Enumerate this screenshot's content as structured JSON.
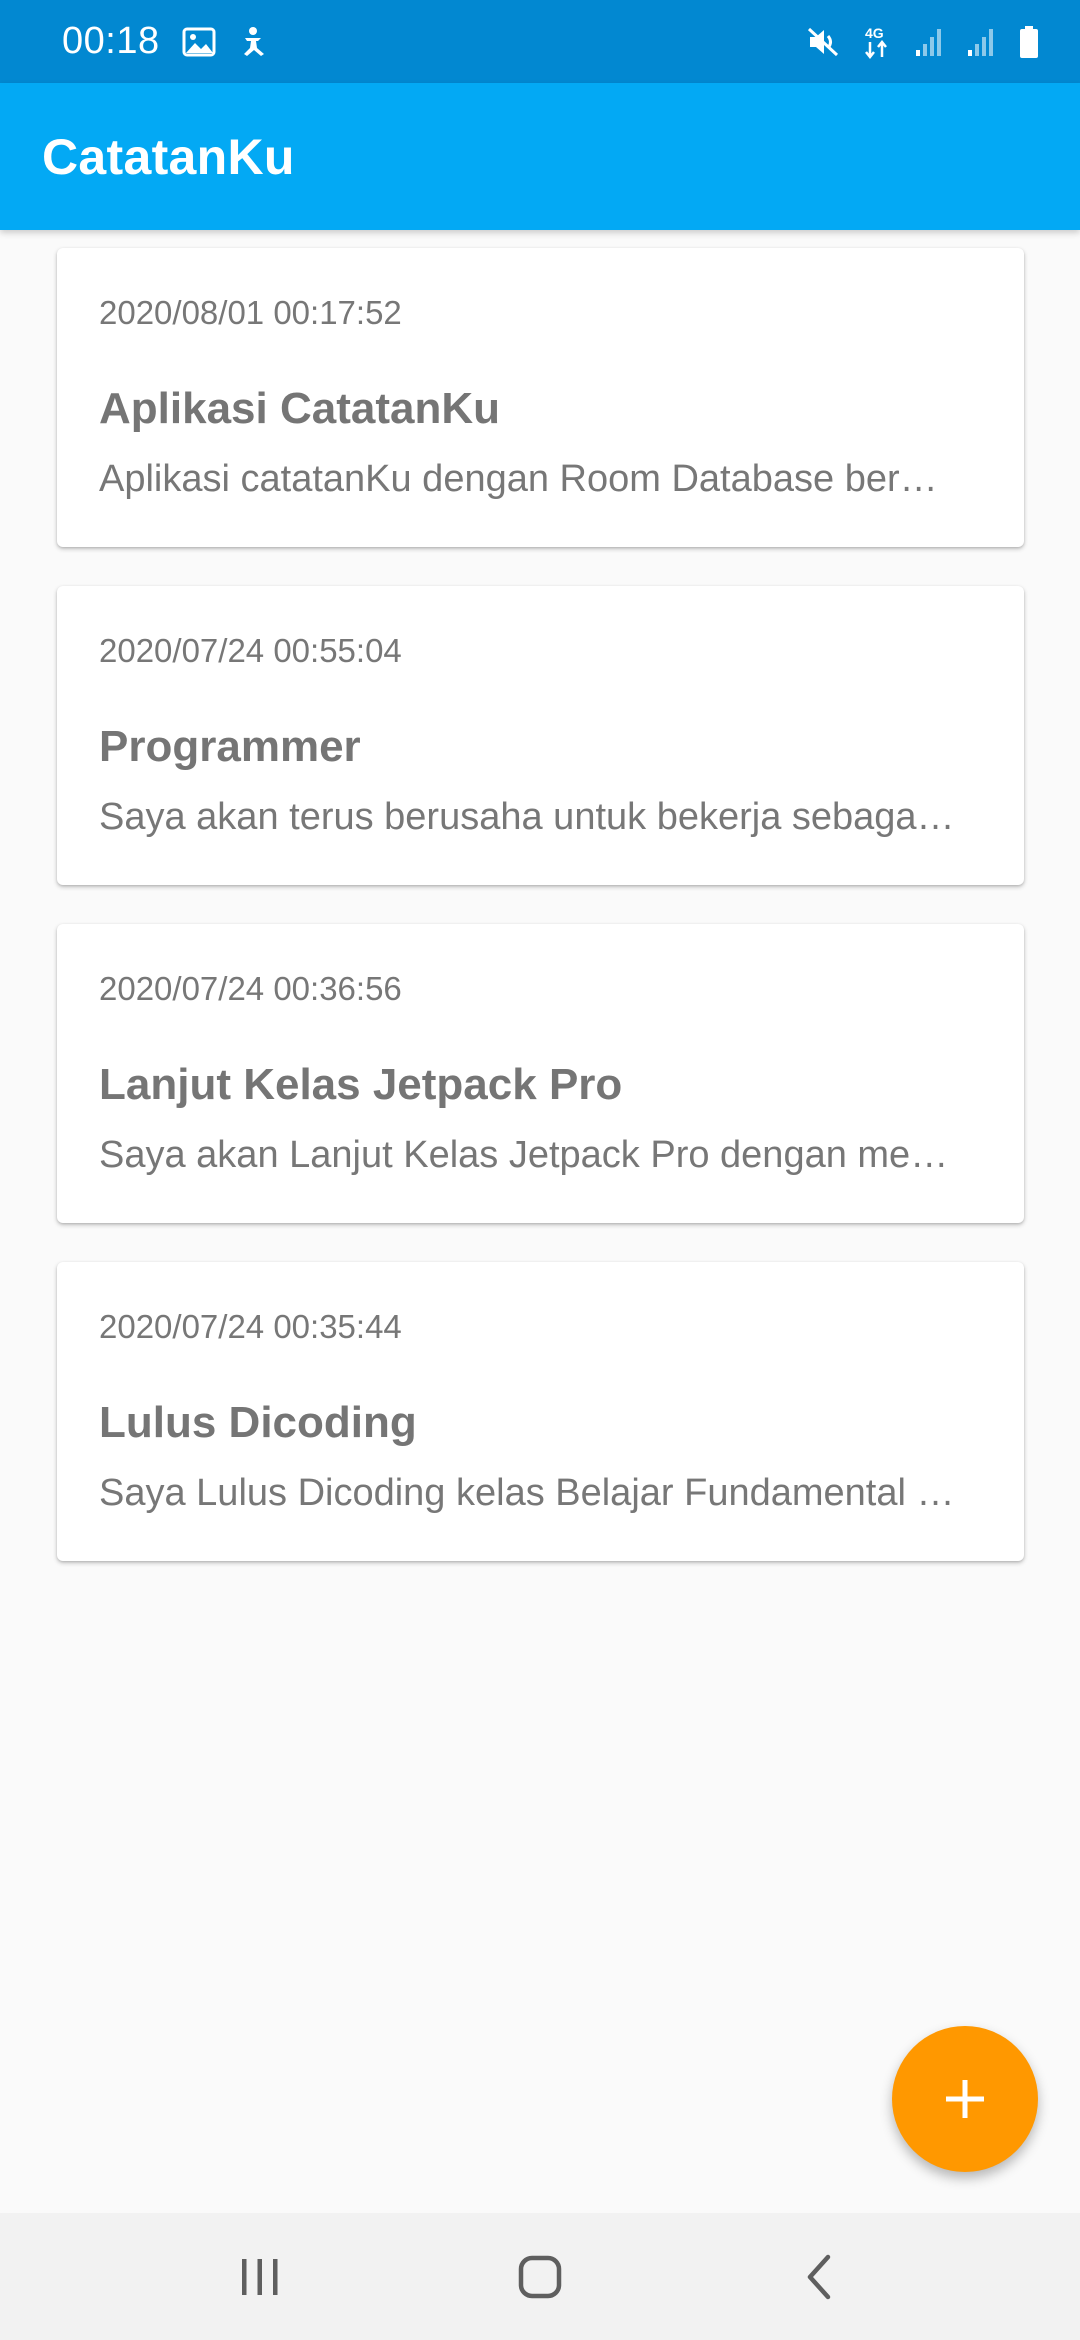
{
  "status_bar": {
    "time": "00:18",
    "icons_left": [
      "image-icon",
      "accessibility-icon"
    ],
    "icons_right": [
      "mute-icon",
      "4g-data-icon",
      "signal-icon",
      "signal-icon",
      "battery-icon"
    ],
    "network_label": "4G"
  },
  "app_bar": {
    "title": "CatatanKu",
    "color": "#03a9f4"
  },
  "notes": [
    {
      "date": "2020/08/01 00:17:52",
      "title": "Aplikasi CatatanKu",
      "description": "Aplikasi catatanKu dengan Room Database ber…"
    },
    {
      "date": "2020/07/24 00:55:04",
      "title": "Programmer",
      "description": "Saya akan terus berusaha untuk bekerja sebaga…"
    },
    {
      "date": "2020/07/24 00:36:56",
      "title": "Lanjut Kelas Jetpack Pro",
      "description": "Saya akan Lanjut Kelas Jetpack Pro dengan me…"
    },
    {
      "date": "2020/07/24 00:35:44",
      "title": "Lulus Dicoding",
      "description": "Saya Lulus Dicoding kelas Belajar Fundamental …"
    }
  ],
  "fab": {
    "icon": "plus-icon",
    "color": "#ff9800"
  },
  "nav_bar": {
    "buttons": [
      "recents-icon",
      "home-icon",
      "back-icon"
    ]
  }
}
